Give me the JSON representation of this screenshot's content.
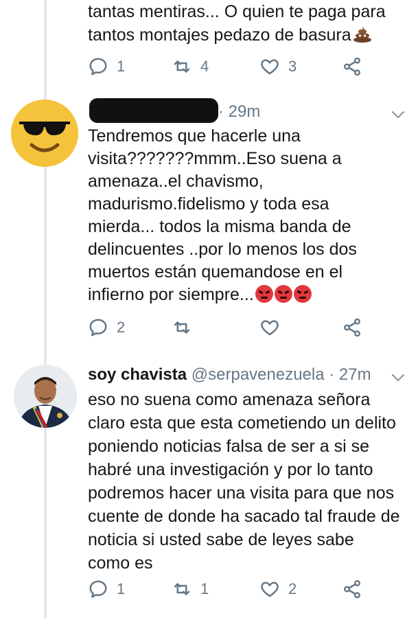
{
  "tweets": [
    {
      "body_lines": [
        "tantas mentiras... O quien te paga para",
        "tantos montajes pedazo de basura"
      ],
      "emoji_trailing": "pile-of-poo",
      "reply_count": "1",
      "retweet_count": "4",
      "like_count": "3"
    },
    {
      "display_name": "",
      "handle": "",
      "time": "· 29m",
      "body": "Tendremos que hacerle una\nvisita???????mmm..Eso suena a\namenaza..el chavismo,\nmadurismo.fidelismo y toda esa\nmierda... todos la misma banda de\ndelincuentes ..por lo menos los dos\nmuertos están quemandose en el\ninfierno por siempre...",
      "emoji_trailing": [
        "angry-face",
        "angry-face",
        "angry-face"
      ],
      "reply_count": "2",
      "retweet_count": "",
      "like_count": ""
    },
    {
      "display_name": "soy chavista",
      "handle": "@serpavenezuela",
      "time": "· 27m",
      "body": "eso no suena como amenaza señora\nclaro esta que esta cometiendo un delito\nponiendo noticias falsa de ser a si se\nhabré una investigación y por lo tanto\npodremos hacer una visita para que nos\ncuente de donde ha sacado tal fraude de\nnoticia si usted sabe de leyes sabe\ncomo es",
      "reply_count": "1",
      "retweet_count": "1",
      "like_count": "2"
    }
  ],
  "icons": {
    "reply": "reply-icon",
    "retweet": "retweet-icon",
    "like": "heart-icon",
    "share": "share-icon",
    "menu": "chevron-down-icon"
  },
  "colors": {
    "text": "#14171a",
    "secondary": "#657786",
    "thread_line": "#e1e8ed",
    "sunglasses_avatar": "#f5c33b"
  }
}
